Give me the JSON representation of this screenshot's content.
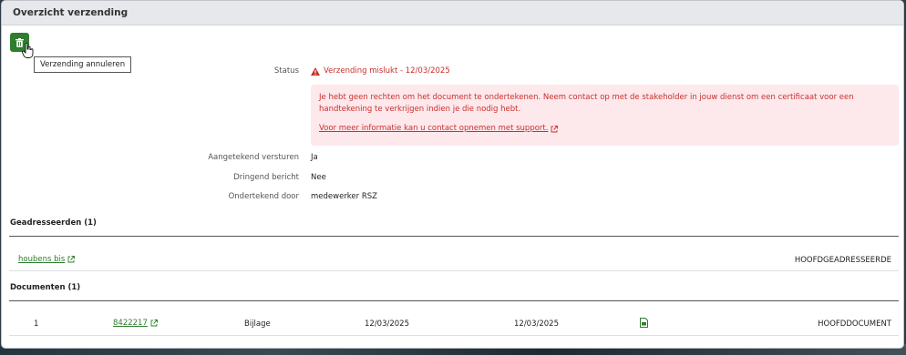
{
  "panel": {
    "title": "Overzicht verzending"
  },
  "toolbar": {
    "delete_tooltip": "Verzending annuleren"
  },
  "details": {
    "status_label": "Status",
    "status_value": "Verzending mislukt - 12/03/2025",
    "alert_text": "Je hebt geen rechten om het document te ondertekenen. Neem contact op met de stakeholder in jouw dienst om een certificaat voor een handtekening te verkrijgen indien je die nodig hebt.",
    "alert_link": "Voor meer informatie kan u contact opnemen met support.",
    "registered_label": "Aangetekend versturen",
    "registered_value": "Ja",
    "urgent_label": "Dringend bericht",
    "urgent_value": "Nee",
    "signed_label": "Ondertekend door",
    "signed_value": "medewerker RSZ"
  },
  "addressees": {
    "title": "Geadresseerden (1)",
    "rows": [
      {
        "name": "houbens bis",
        "role": "HOOFDGEADRESSEERDE"
      }
    ]
  },
  "documents": {
    "title": "Documenten (1)",
    "rows": [
      {
        "index": "1",
        "id": "8422217",
        "type": "Bijlage",
        "date1": "12/03/2025",
        "date2": "12/03/2025",
        "kind": "HOOFDDOCUMENT"
      }
    ]
  },
  "colors": {
    "accent": "#2f7d2f",
    "error": "#c9302c",
    "alert_bg": "#fde8ec"
  }
}
